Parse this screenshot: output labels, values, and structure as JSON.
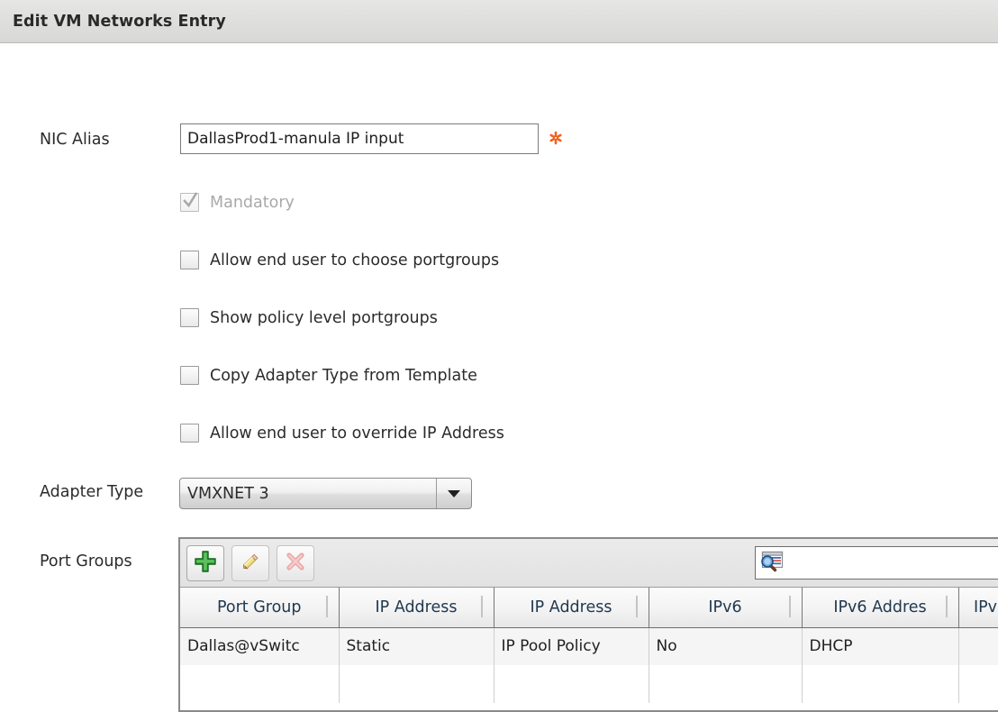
{
  "window": {
    "title": "Edit VM Networks Entry"
  },
  "form": {
    "nic_alias": {
      "label": "NIC Alias",
      "value": "DallasProd1-manula IP input",
      "placeholder": "",
      "required_marker": "*",
      "required_color": "#f4601e"
    },
    "checkboxes": [
      {
        "label": "Mandatory",
        "checked": true,
        "disabled": true
      },
      {
        "label": "Allow end user to choose portgroups",
        "checked": false,
        "disabled": false
      },
      {
        "label": "Show policy level portgroups",
        "checked": false,
        "disabled": false
      },
      {
        "label": "Copy Adapter Type from Template",
        "checked": false,
        "disabled": false
      },
      {
        "label": "Allow end user to override IP Address",
        "checked": false,
        "disabled": false
      }
    ],
    "adapter_type": {
      "label": "Adapter Type",
      "value": "VMXNET 3"
    },
    "port_groups": {
      "label": "Port Groups",
      "toolbar": {
        "add": "add-button",
        "edit": "edit-button",
        "delete": "delete-button"
      },
      "search": {
        "value": "",
        "placeholder": ""
      },
      "table": {
        "columns": [
          "Port Group",
          "IP Address",
          "IP Address",
          "IPv6",
          "IPv6 Addres",
          "IPv"
        ],
        "rows": [
          [
            "Dallas@vSwitc",
            "Static",
            "IP Pool Policy",
            "No",
            "DHCP",
            ""
          ],
          [
            "",
            "",
            "",
            "",
            "",
            ""
          ]
        ]
      }
    }
  }
}
